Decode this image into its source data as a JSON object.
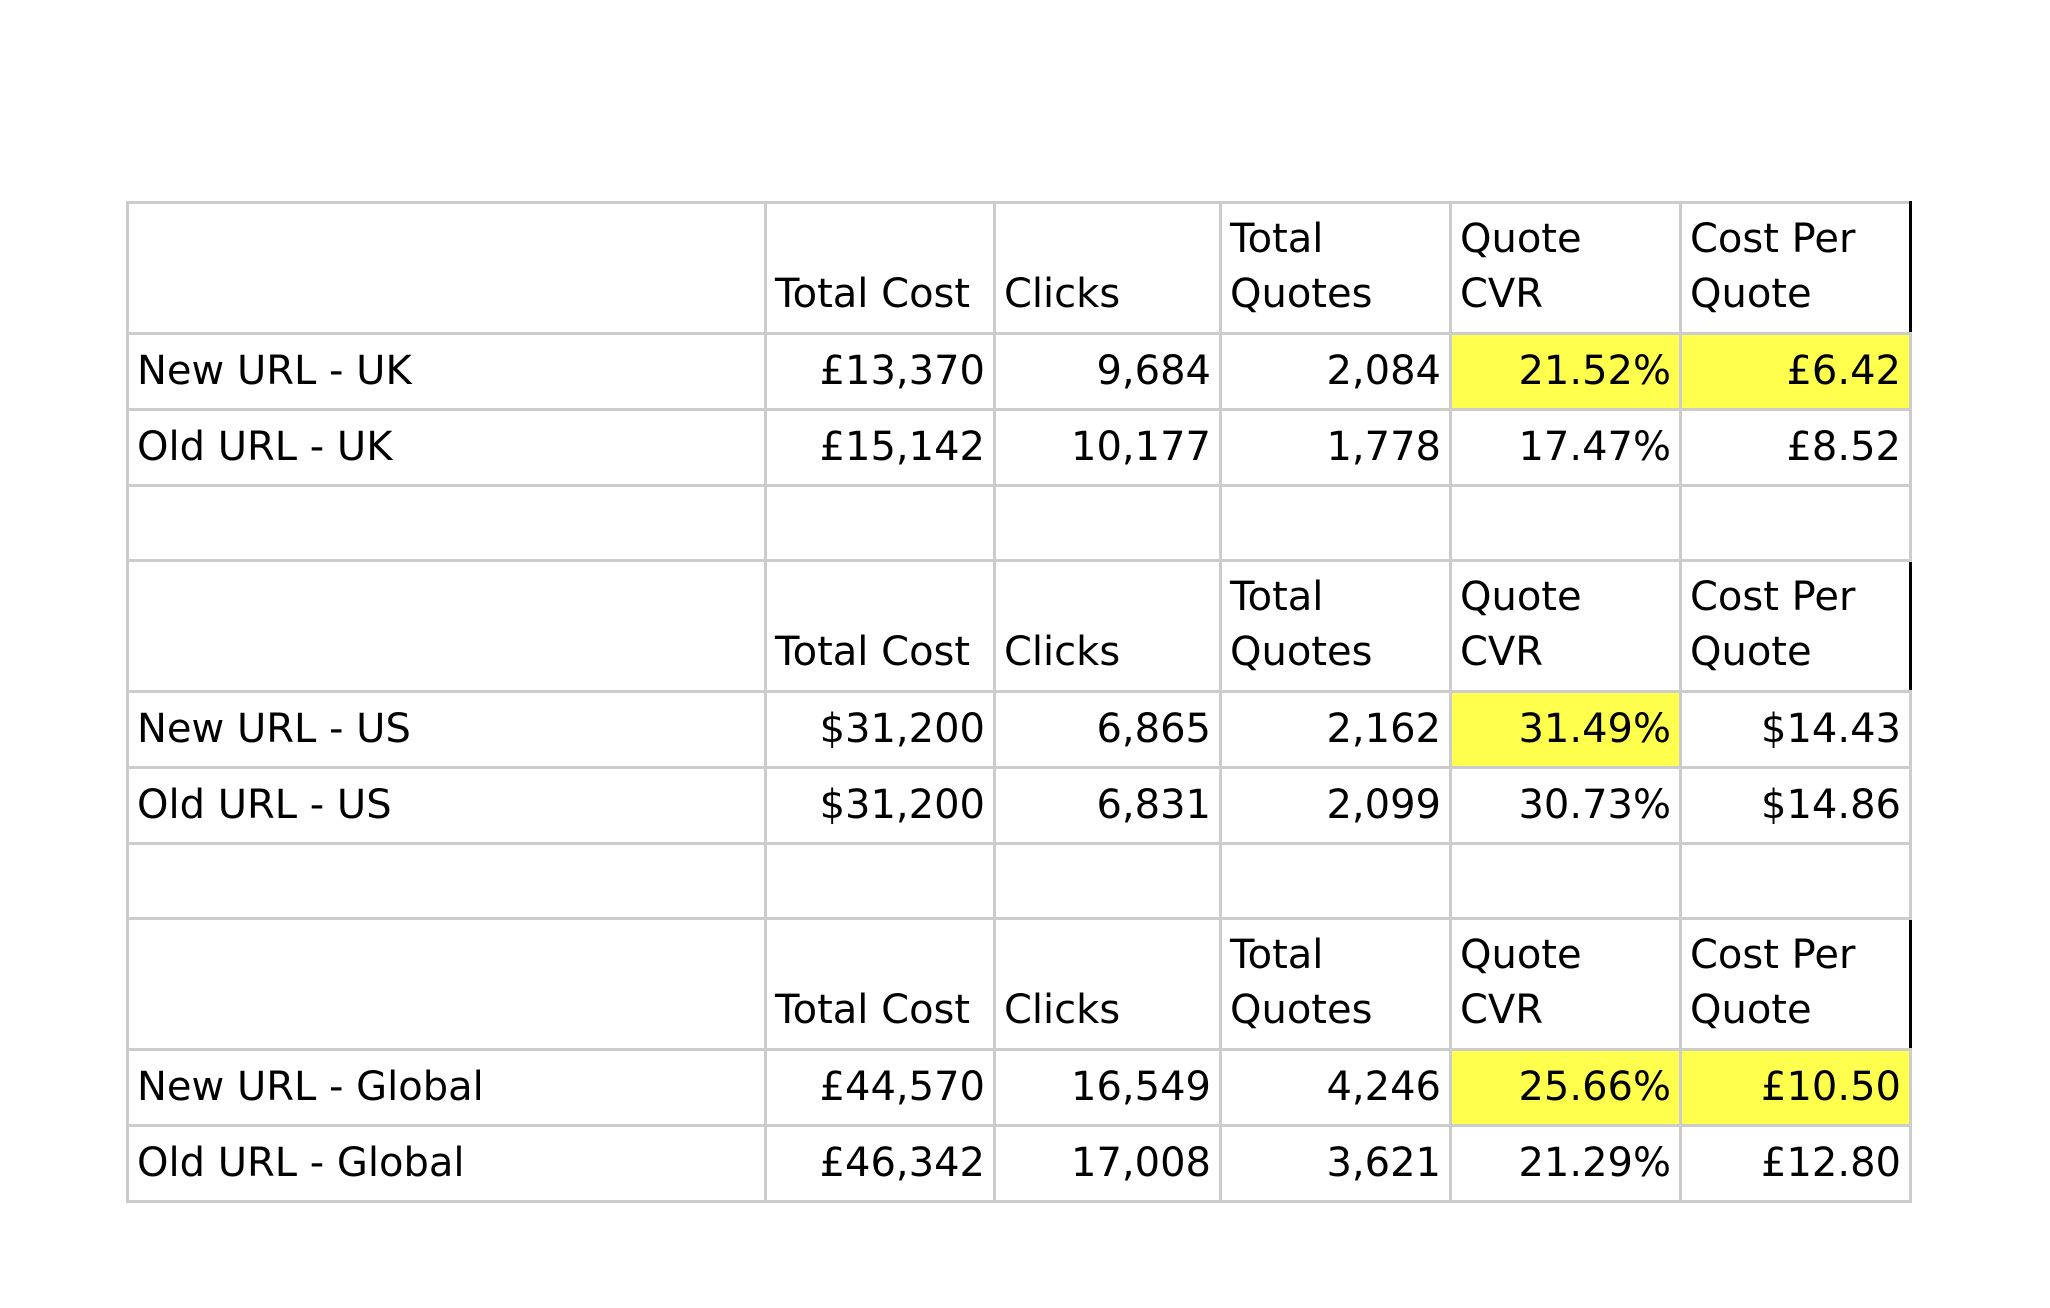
{
  "colors": {
    "highlight": "#ffff4d",
    "grid": "#cccccc"
  },
  "header": {
    "total_cost": "Total Cost",
    "clicks": "Clicks",
    "total_quotes_1": "Total",
    "total_quotes_2": "Quotes",
    "quote_cvr_1": "Quote",
    "quote_cvr_2": "CVR",
    "cost_per_quote_1": "Cost Per",
    "cost_per_quote_2": "Quote"
  },
  "sections": [
    {
      "rows": [
        {
          "label": "New URL - UK",
          "total_cost": "£13,370",
          "clicks": "9,684",
          "total_quotes": "2,084",
          "quote_cvr": "21.52%",
          "cost_per_quote": "£6.42"
        },
        {
          "label": "Old URL - UK",
          "total_cost": "£15,142",
          "clicks": "10,177",
          "total_quotes": "1,778",
          "quote_cvr": "17.47%",
          "cost_per_quote": "£8.52"
        }
      ]
    },
    {
      "rows": [
        {
          "label": "New URL - US",
          "total_cost": "$31,200",
          "clicks": "6,865",
          "total_quotes": "2,162",
          "quote_cvr": "31.49%",
          "cost_per_quote": "$14.43"
        },
        {
          "label": "Old URL - US",
          "total_cost": "$31,200",
          "clicks": "6,831",
          "total_quotes": "2,099",
          "quote_cvr": "30.73%",
          "cost_per_quote": "$14.86"
        }
      ]
    },
    {
      "rows": [
        {
          "label": "New URL - Global",
          "total_cost": "£44,570",
          "clicks": "16,549",
          "total_quotes": "4,246",
          "quote_cvr": "25.66%",
          "cost_per_quote": "£10.50"
        },
        {
          "label": "Old URL - Global",
          "total_cost": "£46,342",
          "clicks": "17,008",
          "total_quotes": "3,621",
          "quote_cvr": "21.29%",
          "cost_per_quote": "£12.80"
        }
      ]
    }
  ]
}
